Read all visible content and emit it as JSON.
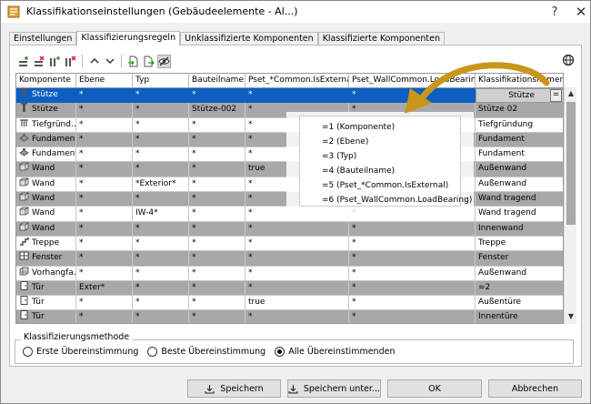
{
  "window": {
    "title": "Klassifikationseinstellungen (Gebäudeelemente - Al...)",
    "help_glyph": "?",
    "close_glyph": "✕"
  },
  "tabs": [
    {
      "label": "Einstellungen"
    },
    {
      "label": "Klassifizierungsregeln"
    },
    {
      "label": "Unklassifizierte Komponenten"
    },
    {
      "label": "Klassifizierte Komponenten"
    }
  ],
  "toolbar": {
    "icons": [
      "add-rule-icon",
      "delete-rule-icon",
      "add-column-icon",
      "delete-column-icon",
      "move-up-icon",
      "move-down-icon",
      "import-icon",
      "export-icon",
      "visibility-toggle-icon"
    ],
    "globe_icon": "globe-icon"
  },
  "grid": {
    "columns": [
      "Komponente",
      "Ebene",
      "Typ",
      "Bauteilname",
      "Pset_*Common.IsExternal",
      "Pset_WallCommon.LoadBearing",
      "Klassifikationsnamen"
    ],
    "rows": [
      {
        "icon": "column-icon",
        "cells": [
          "Stütze",
          "*",
          "*",
          "*",
          "*",
          "*",
          "Stütze"
        ]
      },
      {
        "icon": "column-icon",
        "cells": [
          "Stütze",
          "*",
          "*",
          "Stütze-002",
          "*",
          "*",
          "Stütze 02"
        ]
      },
      {
        "icon": "foundation-icon",
        "cells": [
          "Tiefgründ...",
          "*",
          "*",
          "*",
          "*",
          "*",
          "Tiefgründung"
        ]
      },
      {
        "icon": "footing-icon",
        "cells": [
          "Fundament",
          "*",
          "*",
          "*",
          "*",
          "*",
          "Fundament"
        ]
      },
      {
        "icon": "footing-icon",
        "cells": [
          "Fundament",
          "*",
          "*",
          "*",
          "*",
          "*",
          "Fundament"
        ]
      },
      {
        "icon": "wall-icon",
        "cells": [
          "Wand",
          "*",
          "*",
          "*",
          "true",
          "*",
          "Außenwand"
        ]
      },
      {
        "icon": "wall-icon",
        "cells": [
          "Wand",
          "*",
          "*Exterior*",
          "*",
          "*",
          "*",
          "Außenwand"
        ]
      },
      {
        "icon": "wall-icon",
        "cells": [
          "Wand",
          "*",
          "*",
          "*",
          "*",
          "*",
          "Wand tragend"
        ]
      },
      {
        "icon": "wall-icon",
        "cells": [
          "Wand",
          "*",
          "IW-4*",
          "*",
          "*",
          "*",
          "Wand tragend"
        ]
      },
      {
        "icon": "wall-icon",
        "cells": [
          "Wand",
          "*",
          "*",
          "*",
          "*",
          "*",
          "Innenwand"
        ]
      },
      {
        "icon": "stair-icon",
        "cells": [
          "Treppe",
          "*",
          "*",
          "*",
          "*",
          "*",
          "Treppe"
        ]
      },
      {
        "icon": "window-icon",
        "cells": [
          "Fenster",
          "*",
          "*",
          "*",
          "*",
          "*",
          "Fenster"
        ]
      },
      {
        "icon": "curtain-wall-icon",
        "cells": [
          "Vorhangfa...",
          "*",
          "*",
          "*",
          "*",
          "*",
          "Außenwand"
        ]
      },
      {
        "icon": "door-icon",
        "cells": [
          "Tür",
          "Exter*",
          "*",
          "*",
          "*",
          "*",
          "=2"
        ]
      },
      {
        "icon": "door-icon",
        "cells": [
          "Tür",
          "*",
          "*",
          "*",
          "true",
          "*",
          "Außentüre"
        ]
      },
      {
        "icon": "door-icon",
        "cells": [
          "Tür",
          "*",
          "*",
          "*",
          "*",
          "*",
          "Innentüre"
        ]
      }
    ],
    "selected_row": 0,
    "eq_button": "="
  },
  "popup": {
    "options": [
      "=1 (Komponente)",
      "=2 (Ebene)",
      "=3 (Typ)",
      "=4 (Bauteilname)",
      "=5 (Pset_*Common.IsExternal)",
      "=6 (Pset_WallCommon.LoadBearing)"
    ]
  },
  "method": {
    "legend": "Klassifizierungsmethode",
    "options": [
      {
        "label": "Erste Übereinstimmung",
        "selected": false
      },
      {
        "label": "Beste Übereinstimmung",
        "selected": false
      },
      {
        "label": "Alle Übereinstimmenden",
        "selected": true
      }
    ]
  },
  "buttons": {
    "save": "Speichern",
    "save_as": "Speichern unter...",
    "ok": "OK",
    "cancel": "Abbrechen"
  },
  "colors": {
    "selection": "#0b5fc1",
    "arrow": "#c9961a",
    "alt_row": "#a8a8a8"
  }
}
